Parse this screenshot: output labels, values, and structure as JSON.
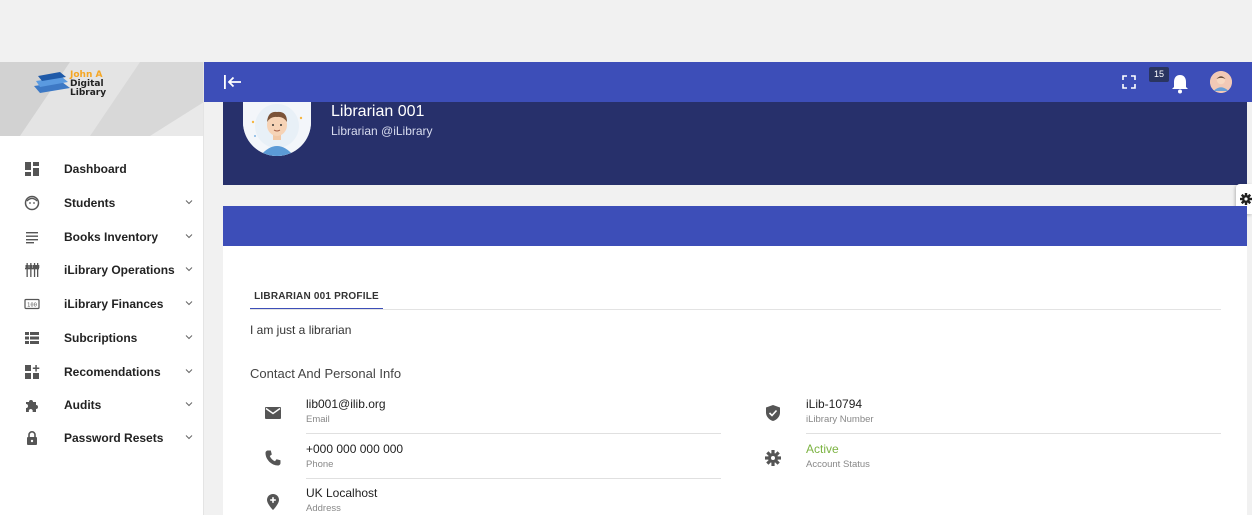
{
  "brand": {
    "line1": "John A",
    "line2": "Digital",
    "line3": "Library"
  },
  "sidebar": {
    "items": [
      {
        "label": "Dashboard",
        "icon": "dashboard-icon",
        "expandable": false
      },
      {
        "label": "Students",
        "icon": "face-icon",
        "expandable": true
      },
      {
        "label": "Books Inventory",
        "icon": "list-icon",
        "expandable": true
      },
      {
        "label": "iLibrary Operations",
        "icon": "equalizer-icon",
        "expandable": true
      },
      {
        "label": "iLibrary Finances",
        "icon": "counter-icon",
        "expandable": true
      },
      {
        "label": "Subcriptions",
        "icon": "view-list-icon",
        "expandable": true
      },
      {
        "label": "Recomendations",
        "icon": "add-dashboard-icon",
        "expandable": true
      },
      {
        "label": "Audits",
        "icon": "puzzle-icon",
        "expandable": true
      },
      {
        "label": "Password Resets",
        "icon": "lock-icon",
        "expandable": true
      }
    ]
  },
  "topbar": {
    "notification_count": "15"
  },
  "profile": {
    "name": "Librarian 001",
    "subtitle": "Librarian @iLibrary"
  },
  "tabs": {
    "active": "LIBRARIAN 001 PROFILE"
  },
  "bio": "I am just a librarian",
  "contact": {
    "heading": "Contact And Personal Info",
    "left": [
      {
        "value": "lib001@ilib.org",
        "label": "Email",
        "icon": "mail-icon"
      },
      {
        "value": "+000 000 000 000",
        "label": "Phone",
        "icon": "phone-icon"
      },
      {
        "value": "UK Localhost",
        "label": "Address",
        "icon": "location-icon"
      }
    ],
    "right": [
      {
        "value": "iLib-10794",
        "label": "iLibrary Number",
        "icon": "verified-shield-icon"
      },
      {
        "value": "Active",
        "label": "Account Status",
        "icon": "gear-icon"
      }
    ]
  },
  "colors": {
    "primary": "#3d4eb8",
    "header_dark": "#27306b",
    "status_active": "#7cb342",
    "logo_orange": "#f5a623"
  }
}
